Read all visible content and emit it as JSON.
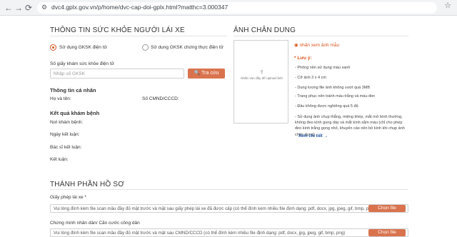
{
  "browser": {
    "url": "dvc4.gplx.gov.vn/p/home/dvc-cap-doi-gplx.html?matthc=3.000347",
    "back_icon": "←",
    "forward_icon": "→",
    "reload_icon": "⟳"
  },
  "health": {
    "title": "THÔNG TIN SỨC KHỎE NGƯỜI LÁI XE",
    "option_electronic": "Sử dụng GKSK điện tử",
    "option_certified": "Sử dụng GKSK chứng thực điện tử",
    "number_label": "Số giấy khám sức khỏe điện tử",
    "number_placeholder": "Nhập số GKSK",
    "lookup_button": "Tra cứu",
    "personal_title": "Thông tin cá nhân",
    "name_label": "Họ và tên:",
    "id_label": "Số CMND/CCCD:",
    "result_title": "Kết quả khám bệnh",
    "place_label": "Nơi khám bệnh:",
    "date_label": "Ngày kết luận:",
    "doctor_label": "Bác sĩ kết luận:",
    "conclusion_label": "Kết luận:"
  },
  "portrait": {
    "title": "ẢNH CHÂN DUNG",
    "upload_hint": "Nhấn vào đây để upload ảnh",
    "sample_link": "nhấn xem ảnh mẫu",
    "notes_title": "* Lưu ý:",
    "notes": [
      "- Phông nền sử dụng màu xanh",
      "- Cỡ ảnh 3 x 4 cm",
      "- Dung lượng file ảnh không vượt quá 3MB",
      "- Trang phục nên tránh màu trắng và màu đen",
      "- Đầu không được nghiêng quá 5 độ"
    ],
    "long_note": "- Sử dụng ảnh chụp thẳng, miệng khép, mắt mở bình thường, không đeo kính gọng dày và mắt kính sẫm màu (chỉ cho phép đeo kính trắng gọng nhỏ, khuyến cáo nên bỏ kính khi chụp ảnh chân dung).",
    "details_link": "Xem chi tiết →"
  },
  "documents": {
    "title": "THÀNH PHẦN HỒ SƠ",
    "license_label": "Giấy phép lái xe *",
    "license_placeholder": "Vui lòng đính kèm file scan mầu đầy đủ mặt trước và mặt sau giấy phép lái xe đã được cấp (có thể đính kèm nhiều file định dạng: pdf, docx, jpg, jpeg, gif, bmp, png)",
    "id_label": "Chứng minh nhân dân/ Căn cước công dân",
    "id_placeholder": "Vui lòng đính kèm file scan mầu đầy đủ mặt trước và mặt sau CMND/CCCD (có thể đính kèm nhiều file định dạng: pdf, docx, jpg, jpeg, gif, bmp, png)",
    "choose_file": "Chọn file"
  },
  "colors": {
    "accent": "#d9734e",
    "radio_active": "#d9531e",
    "link": "#1a4f9c"
  }
}
